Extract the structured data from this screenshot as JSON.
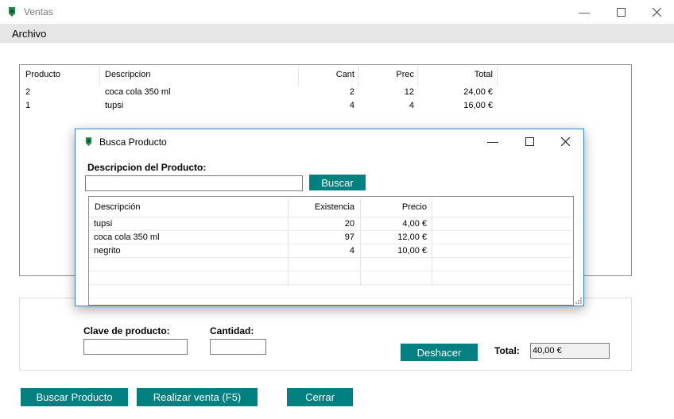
{
  "window": {
    "title": "Ventas"
  },
  "menu": {
    "items": [
      {
        "label": "Archivo"
      }
    ]
  },
  "sales_grid": {
    "columns": [
      "Producto",
      "Descripcion",
      "Cant",
      "Prec",
      "Total"
    ],
    "rows": [
      [
        "2",
        "coca cola 350 ml",
        "2",
        "12",
        "24,00 €"
      ],
      [
        "1",
        "tupsi",
        "4",
        "4",
        "16,00 €"
      ]
    ]
  },
  "form": {
    "clave_label": "Clave de producto:",
    "clave_value": "",
    "cantidad_label": "Cantidad:",
    "cantidad_value": "",
    "deshacer_label": "Deshacer",
    "total_label": "Total:",
    "total_value": "40,00 €"
  },
  "buttons": {
    "buscar_producto": "Buscar Producto",
    "realizar_venta": "Realizar venta (F5)",
    "cerrar": "Cerrar"
  },
  "dialog": {
    "title": "Busca Producto",
    "desc_label": "Descripcion del Producto:",
    "search_value": "",
    "search_button": "Buscar",
    "columns": [
      "Descripción",
      "Existencia",
      "Precio"
    ],
    "rows": [
      [
        "tupsi",
        "20",
        "4,00 €"
      ],
      [
        "coca cola 350 ml",
        "97",
        "12,00 €"
      ],
      [
        "negrito",
        "4",
        "10,00 €"
      ]
    ]
  },
  "colors": {
    "accent": "#008080",
    "dialog_border": "#3a87c9",
    "menubar": "#e6e6e6"
  },
  "icons": [
    "app-icon",
    "minimize-icon",
    "maximize-icon",
    "close-icon"
  ]
}
